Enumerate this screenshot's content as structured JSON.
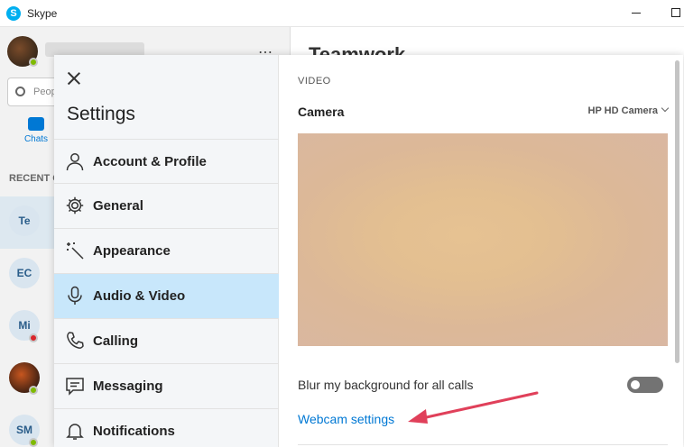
{
  "window": {
    "title": "Skype",
    "logo_letter": "S"
  },
  "background": {
    "search_placeholder": "Peop",
    "chats_label": "Chats",
    "recent_label": "RECENT C",
    "main_title": "Teamwork",
    "contacts": [
      {
        "initials": "Te",
        "status": ""
      },
      {
        "initials": "EC",
        "status": ""
      },
      {
        "initials": "Mi",
        "status": "busy"
      },
      {
        "initials": "",
        "status": "online"
      },
      {
        "initials": "SM",
        "status": "online"
      }
    ]
  },
  "settings": {
    "title": "Settings",
    "nav": [
      {
        "label": "Account & Profile",
        "icon": "person-icon",
        "active": false
      },
      {
        "label": "General",
        "icon": "gear-icon",
        "active": false
      },
      {
        "label": "Appearance",
        "icon": "magic-wand-icon",
        "active": false
      },
      {
        "label": "Audio & Video",
        "icon": "microphone-icon",
        "active": true
      },
      {
        "label": "Calling",
        "icon": "phone-icon",
        "active": false
      },
      {
        "label": "Messaging",
        "icon": "message-icon",
        "active": false
      },
      {
        "label": "Notifications",
        "icon": "bell-icon",
        "active": false
      }
    ],
    "content": {
      "section": "VIDEO",
      "camera_label": "Camera",
      "camera_value": "HP HD Camera",
      "blur_label": "Blur my background for all calls",
      "blur_enabled": false,
      "webcam_link": "Webcam settings"
    }
  },
  "colors": {
    "accent": "#0078d4",
    "active_nav": "#c8e7fb",
    "annotation_arrow": "#e0405a"
  }
}
